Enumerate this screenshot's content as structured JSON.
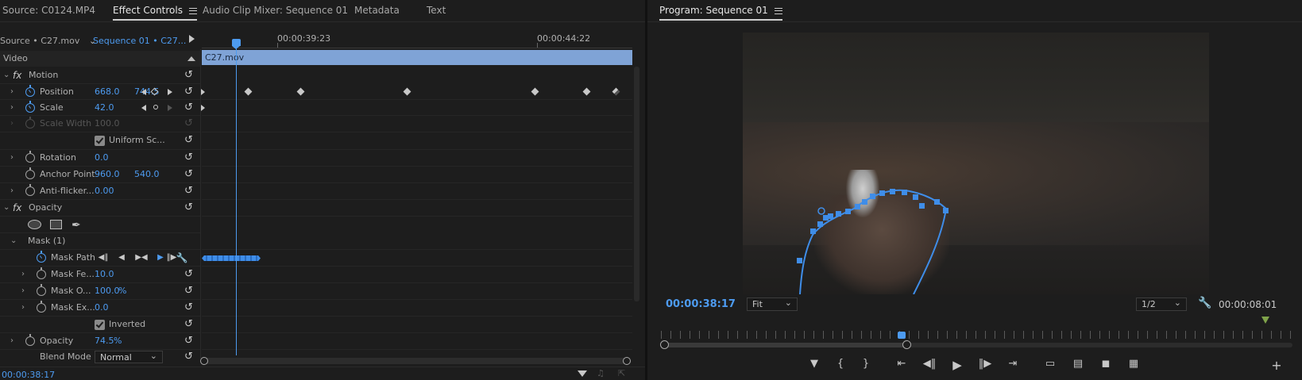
{
  "left_tabs": [
    {
      "label": "Source: C0124.MP4"
    },
    {
      "label": "Effect Controls"
    },
    {
      "label": "Audio Clip Mixer: Sequence 01"
    },
    {
      "label": "Metadata"
    },
    {
      "label": "Text"
    }
  ],
  "effect_header": {
    "source": "Source • C27.mov",
    "sequence": "Sequence 01 • C27...",
    "time1": "00:00:39:23",
    "time2": "00:00:44:22",
    "clip_name": "C27.mov"
  },
  "section_video": "Video",
  "fx_symbol": "fx",
  "params": {
    "motion": "Motion",
    "position_label": "Position",
    "position_x": "668.0",
    "position_y": "744.5",
    "scale_label": "Scale",
    "scale_val": "42.0",
    "scale_width_label": "Scale Width",
    "scale_width_val": "100.0",
    "uniform_scale_label": "Uniform Sc...",
    "rotation_label": "Rotation",
    "rotation_val": "0.0",
    "anchor_label": "Anchor Point",
    "anchor_x": "960.0",
    "anchor_y": "540.0",
    "antiflicker_label": "Anti-flicker...",
    "antiflicker_val": "0.00",
    "opacity_group": "Opacity",
    "mask_label": "Mask (1)",
    "mask_path_label": "Mask Path",
    "mask_feather_label": "Mask Fe...",
    "mask_feather_val": "10.0",
    "mask_opacity_label": "Mask O...",
    "mask_opacity_val": "100.0",
    "mask_opacity_unit": "%",
    "mask_expansion_label": "Mask Ex...",
    "mask_expansion_val": "0.0",
    "inverted_label": "Inverted",
    "opacity_label": "Opacity",
    "opacity_val": "74.5",
    "opacity_unit": "%",
    "blend_label": "Blend Mode",
    "blend_val": "Normal"
  },
  "bottom_timecode": "00:00:38:17",
  "program": {
    "title": "Program: Sequence 01",
    "timecode": "00:00:38:17",
    "fit": "Fit",
    "resolution": "1/2",
    "duration": "00:00:08:01"
  },
  "colors": {
    "accent": "#4d9bf0",
    "clip_bar": "#7fa3d6",
    "panel_bg": "#1d1d1d"
  }
}
